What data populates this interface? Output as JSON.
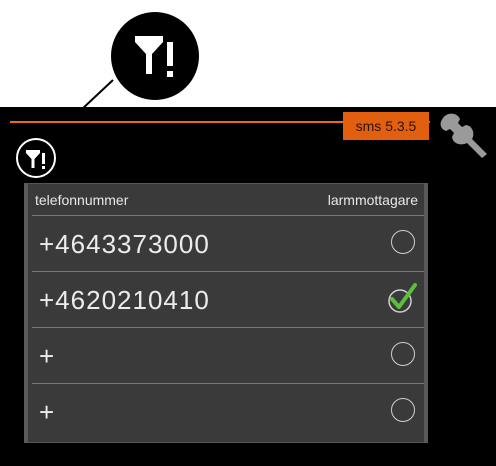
{
  "header": {
    "menu_code": "sms 5.3.5"
  },
  "table": {
    "columns": [
      "telefonnummer",
      "larmmottagare"
    ],
    "rows": [
      {
        "phone": "+4643373000",
        "alarm_receiver": false
      },
      {
        "phone": "+4620210410",
        "alarm_receiver": true
      },
      {
        "phone": "+",
        "alarm_receiver": false
      },
      {
        "phone": "+",
        "alarm_receiver": false
      }
    ]
  },
  "icons": {
    "badge": "filter-warning-icon",
    "tool": "wrench-icon",
    "selected": "check-icon",
    "unselected": "radio-empty-icon"
  },
  "colors": {
    "accent": "#f06a14",
    "check": "#5bbf3c",
    "panel": "#3a3a3a",
    "background": "#000000"
  }
}
